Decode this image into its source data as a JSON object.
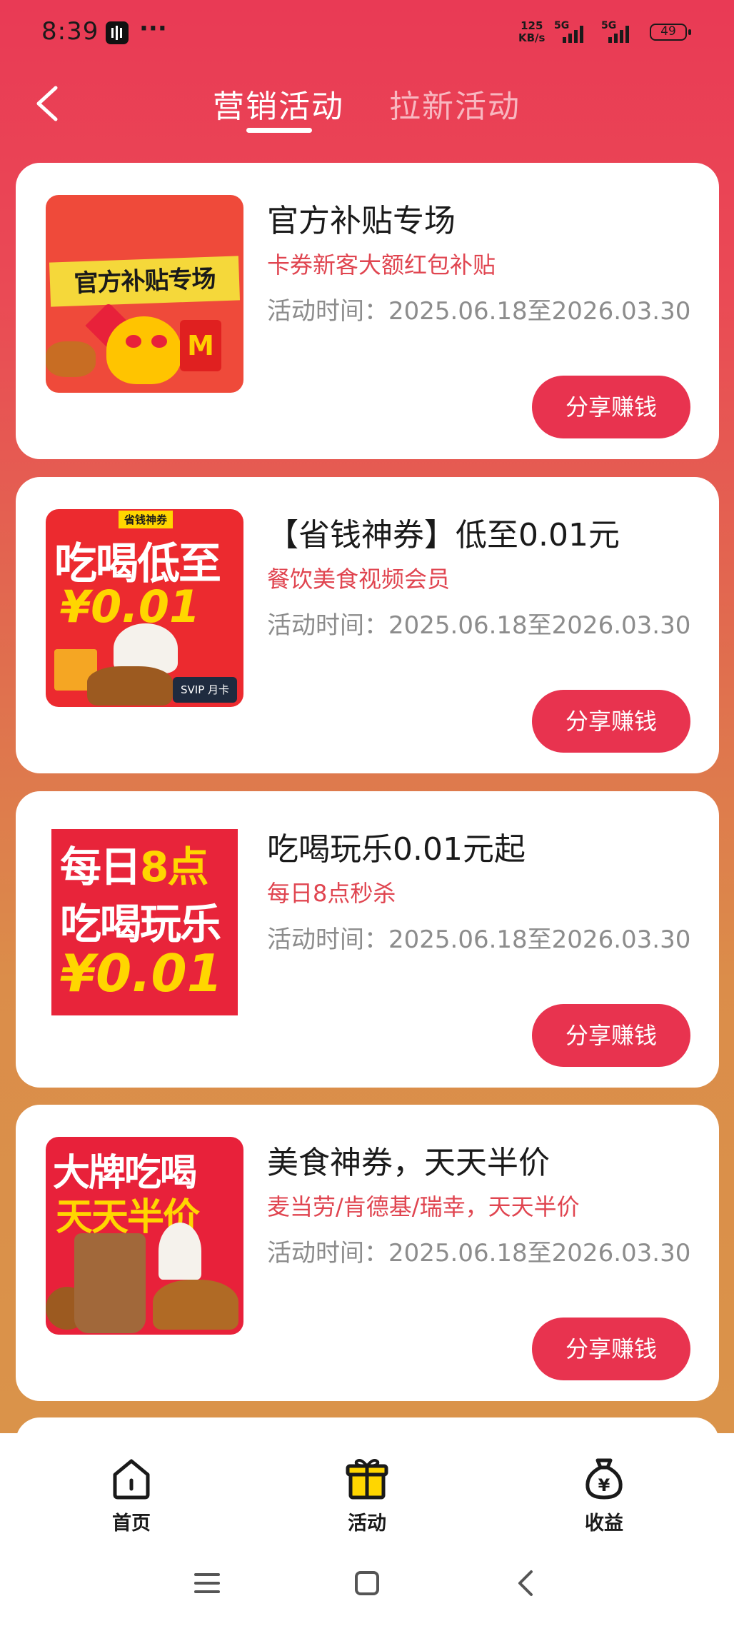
{
  "status_bar": {
    "time": "8:39",
    "more": "···",
    "speed_top": "125",
    "speed_bottom": "KB/s",
    "net1": "5G",
    "net2": "5G",
    "battery": "49"
  },
  "header": {
    "tabs": [
      {
        "label": "营销活动",
        "active": true
      },
      {
        "label": "拉新活动",
        "active": false
      }
    ]
  },
  "cards": [
    {
      "title": "官方补贴专场",
      "subtitle": "卡券新客大额红包补贴",
      "time_label": "活动时间：",
      "time_range": "2025.06.18至2026.03.30",
      "button": "分享赚钱",
      "image_text": {
        "banner": "官方补贴专场",
        "logo": "M"
      }
    },
    {
      "title": "【省钱神券】低至0.01元",
      "subtitle": "餐饮美食视频会员",
      "time_label": "活动时间：",
      "time_range": "2025.06.18至2026.03.30",
      "button": "分享赚钱",
      "image_text": {
        "tag": "省钱神券",
        "line1": "吃喝低至",
        "line2": "¥0.01",
        "badge": "SVIP 月卡"
      }
    },
    {
      "title": "吃喝玩乐0.01元起",
      "subtitle": "每日8点秒杀",
      "time_label": "活动时间：",
      "time_range": "2025.06.18至2026.03.30",
      "button": "分享赚钱",
      "image_text": {
        "line1_a": "每日",
        "line1_b": "8点",
        "line2": "吃喝玩乐",
        "line3": "¥0.01"
      }
    },
    {
      "title": "美食神券，天天半价",
      "subtitle": "麦当劳/肯德基/瑞幸，天天半价",
      "time_label": "活动时间：",
      "time_range": "2025.06.18至2026.03.30",
      "button": "分享赚钱",
      "image_text": {
        "line1": "大牌吃喝",
        "line2": "天天半价"
      }
    }
  ],
  "bottom_nav": [
    {
      "label": "首页",
      "icon": "home-icon"
    },
    {
      "label": "活动",
      "icon": "gift-icon"
    },
    {
      "label": "收益",
      "icon": "money-bag-icon"
    }
  ],
  "colors": {
    "accent": "#e8334f",
    "subtitle": "#e04550",
    "tab_active": "#ffffff",
    "tab_inactive": "#f8b7c0"
  }
}
